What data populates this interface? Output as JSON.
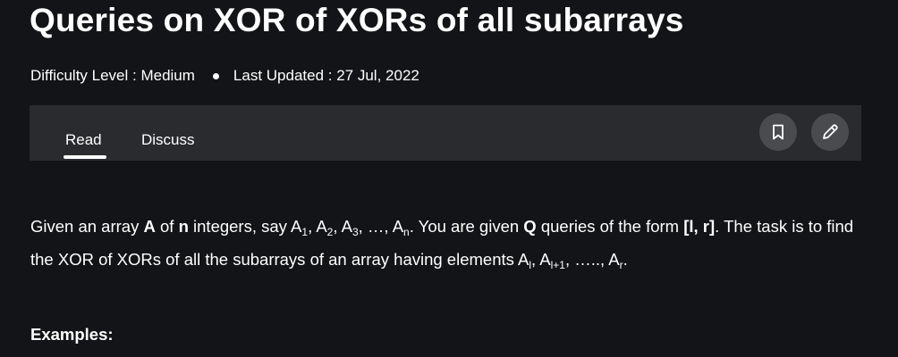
{
  "article": {
    "title": "Queries on XOR of XORs of all subarrays",
    "difficulty": "Difficulty Level : Medium",
    "last_updated": "Last Updated : 27 Jul, 2022"
  },
  "tabs": {
    "read": "Read",
    "discuss": "Discuss"
  },
  "icons": {
    "bookmark": "bookmark-icon",
    "edit": "pencil-icon"
  },
  "body": {
    "p1": "Given an array ",
    "A": "A",
    "p2": " of ",
    "n": "n",
    "p3": " integers, say A",
    "s1": "1",
    "p4": ", A",
    "s2": "2",
    "p5": ", A",
    "s3": "3",
    "p6": ", …, A",
    "sn": "n",
    "p7": ". You are given ",
    "Q": "Q",
    "p8": " queries of the form ",
    "lr": "[l, r]",
    "p9": ". The task is to find the XOR of XORs of all the subarrays of an array having elements A",
    "sl": "l",
    "p10": ", A",
    "sl1": "l+1",
    "p11": ", ….., A",
    "sr": "r",
    "p12": "."
  },
  "examples_heading": "Examples:",
  "colors": {
    "background": "#131417",
    "tabbar": "#2a2b2f",
    "icon_button": "#4a4b4f",
    "text": "#ffffff"
  }
}
